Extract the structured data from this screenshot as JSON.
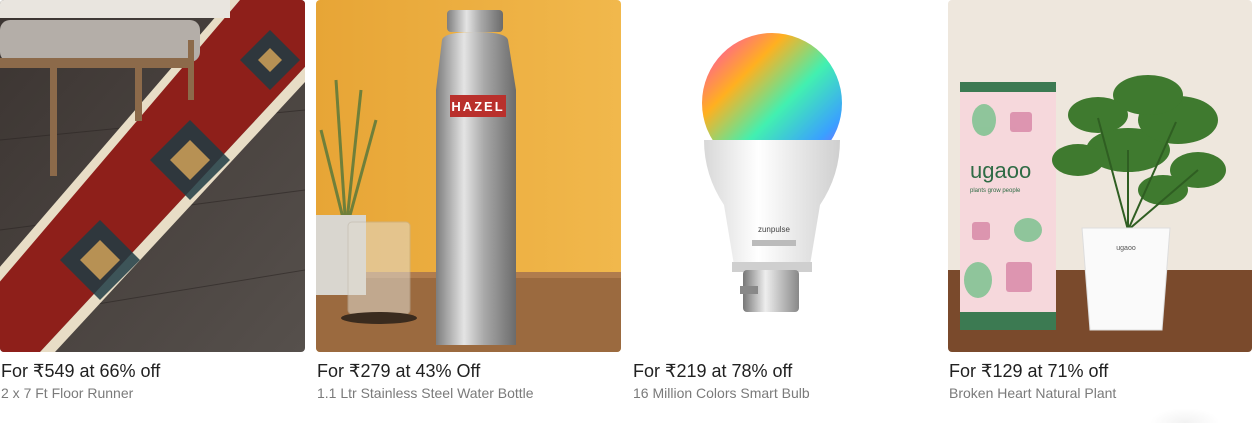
{
  "offers": [
    {
      "price": "For ₹549 at 66% off",
      "title": "2 x 7 Ft Floor Runner",
      "image": "floor-runner-image"
    },
    {
      "price": "For ₹279 at 43% Off",
      "title": "1.1 Ltr Stainless Steel Water Bottle",
      "image": "water-bottle-image",
      "brand": "HAZEL"
    },
    {
      "price": "For ₹219 at 78% off",
      "title": "16 Million Colors Smart Bulb",
      "image": "smart-bulb-image",
      "brand": "zunpulse"
    },
    {
      "price": "For ₹129 at 71% off",
      "title": "Broken Heart Natural Plant",
      "image": "plant-image",
      "brand": "ugaoo",
      "tagline": "plants grow people"
    }
  ]
}
